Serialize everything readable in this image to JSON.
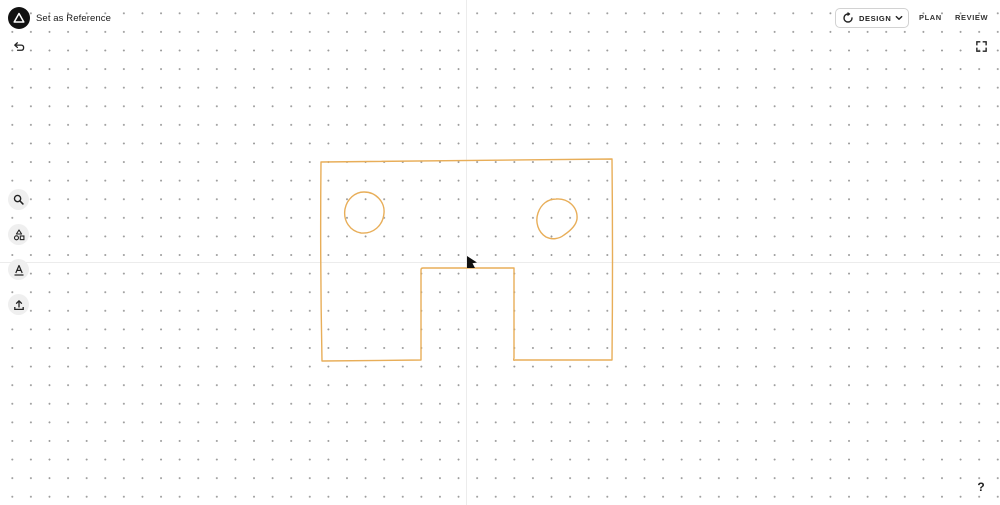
{
  "header": {
    "reference_label": "Set as Reference",
    "mode": {
      "selected": "DESIGN",
      "icon": "refresh-icon",
      "dropdown_icon": "chevron-down-icon"
    },
    "tabs": [
      "PLAN",
      "REVIEW"
    ]
  },
  "toolbar": {
    "undo_icon": "undo-icon",
    "fullscreen_icon": "fullscreen-icon",
    "tools": [
      {
        "name": "search",
        "icon": "search-icon"
      },
      {
        "name": "shapes",
        "icon": "shapes-icon"
      },
      {
        "name": "text",
        "icon": "text-icon"
      },
      {
        "name": "upload",
        "icon": "upload-icon"
      }
    ]
  },
  "help": {
    "label": "?"
  },
  "canvas": {
    "background": "dotted-grid",
    "sketch": {
      "stroke_color": "#E8AE59",
      "description_shapes": [
        "rectangle-outline-with-notch",
        "circle-left",
        "circle-right"
      ]
    }
  },
  "colors": {
    "accent_sketch": "#E8AE59",
    "logo_bg": "#111111",
    "tool_bg": "#EFEFEF",
    "grid_dot": "#9C9C9C"
  }
}
